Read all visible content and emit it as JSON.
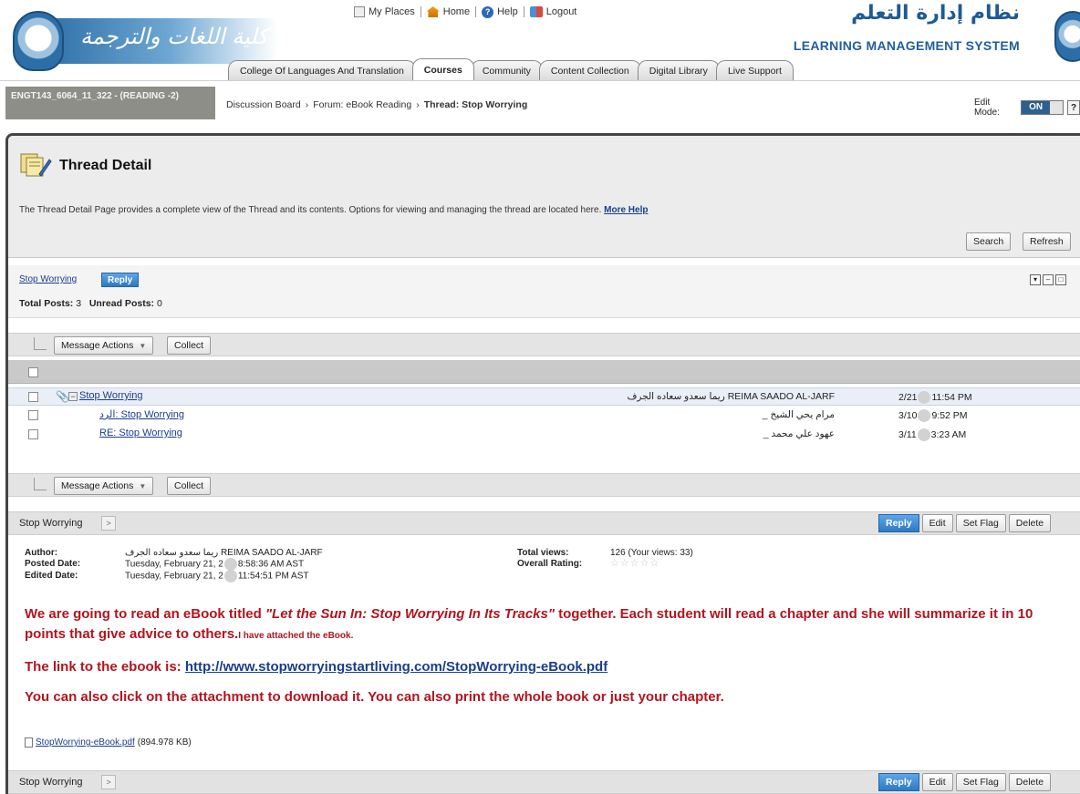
{
  "header": {
    "college_logo_text": "كلية اللغات والترجمة",
    "top_links": {
      "my_places": "My Places",
      "home": "Home",
      "help": "Help",
      "logout": "Logout"
    },
    "lms_title_arabic": "نظام إدارة التعلم",
    "lms_title_english": "LEARNING MANAGEMENT SYSTEM",
    "tabs": [
      {
        "label": "College Of Languages And Translation",
        "active": false
      },
      {
        "label": "Courses",
        "active": true
      },
      {
        "label": "Community",
        "active": false
      },
      {
        "label": "Content Collection",
        "active": false
      },
      {
        "label": "Digital Library",
        "active": false
      },
      {
        "label": "Live Support",
        "active": false
      }
    ]
  },
  "crumbbar": {
    "course_name": "ENGT143_6064_11_322 - (READING -2)",
    "breadcrumb": {
      "level1": "Discussion Board",
      "level2": "Forum: eBook Reading",
      "current": "Thread: Stop Worrying",
      "separator": "›"
    },
    "edit_mode_label": "Edit Mode:",
    "edit_mode_value": "ON",
    "edit_mode_help": "?"
  },
  "page": {
    "title": "Thread Detail",
    "description": "The Thread Detail Page provides a complete view of the Thread and its contents. Options for viewing and managing the thread are located here.",
    "more_help": "More Help",
    "search_label": "Search",
    "refresh_label": "Refresh"
  },
  "summary": {
    "thread_link": "Stop Worrying",
    "reply_label": "Reply",
    "total_posts_label": "Total Posts:",
    "total_posts": "3",
    "unread_posts_label": "Unread Posts:",
    "unread_posts": "0"
  },
  "actions": {
    "message_actions": "Message Actions",
    "collect": "Collect"
  },
  "thread_rows": [
    {
      "subject": "Stop Worrying",
      "author": "ريما سعدو سعاده الجرف REIMA SAADO AL-JARF",
      "date_prefix": "2/21",
      "date_suffix": "11:54 PM"
    },
    {
      "subject": "الرد: Stop Worrying",
      "author": "_ مرام يحي الشيخ",
      "date_prefix": "3/10",
      "date_suffix": "9:52 PM"
    },
    {
      "subject": "RE: Stop Worrying",
      "author": "_ عهود علي محمد",
      "date_prefix": "3/11",
      "date_suffix": "3:23 AM"
    }
  ],
  "post": {
    "title": "Stop Worrying",
    "buttons": {
      "reply": "Reply",
      "edit": "Edit",
      "set_flag": "Set Flag",
      "delete": "Delete"
    },
    "author_label": "Author:",
    "author": "ريما سعدو سعاده الجرف REIMA SAADO AL-JARF",
    "posted_label": "Posted Date:",
    "posted_prefix": "Tuesday, February 21, 2",
    "posted_suffix": "8:58:36 AM AST",
    "edited_label": "Edited Date:",
    "edited_prefix": "Tuesday, February 21, 2",
    "edited_suffix": "11:54:51 PM AST",
    "views_label": "Total views:",
    "views": "126 (Your views: 33)",
    "rating_label": "Overall Rating:",
    "body": {
      "p1_start": "We are going to read an eBook titled ",
      "p1_title": "\"Let the Sun In: Stop Worrying In Its Tracks\"",
      "p1_end": " together. Each student will read a chapter and she will summarize it in 10 points that give advice to others.",
      "p1_small": "I have attached the eBook.",
      "p2_label": "The link to the ebook is: ",
      "p2_link": "http://www.stopworryingstartliving.com/StopWorrying-eBook.pdf",
      "p3": "You can also click on the attachment to download it. You can also print the whole book or just your chapter."
    },
    "attachment_name": "StopWorrying-eBook.pdf",
    "attachment_size": "(894.978 KB)"
  },
  "next_post": {
    "title": "Stop Worrying"
  }
}
